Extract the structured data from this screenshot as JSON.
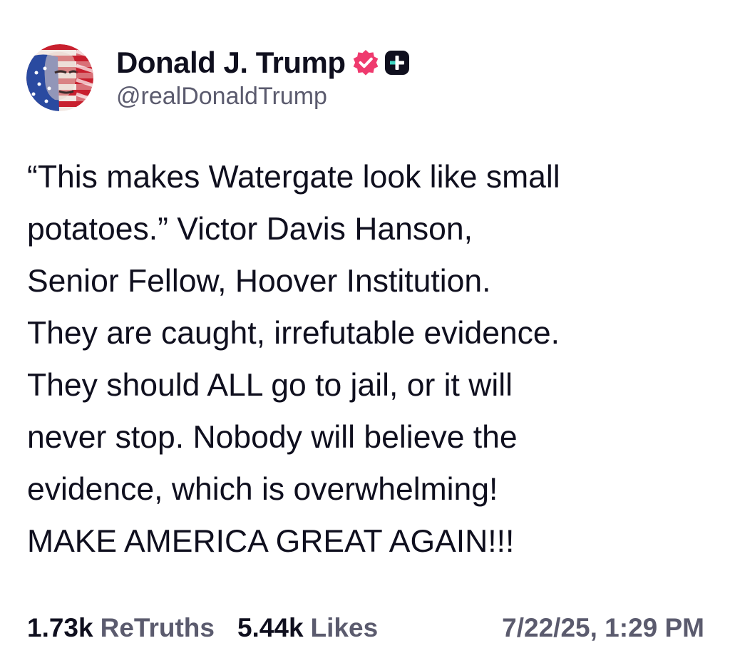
{
  "author": {
    "name": "Donald J. Trump",
    "handle": "@realDonaldTrump",
    "verified_color": "#ef3a6e",
    "plus_badge_color": "#0f0f1e",
    "avatar_icon": "profile-photo-flag-avatar"
  },
  "post": {
    "lines": [
      "“This makes Watergate look like small",
      "potatoes.” Victor Davis Hanson,",
      "Senior Fellow, Hoover Institution.",
      "They are caught, irrefutable evidence.",
      "They should ALL go to jail, or it will",
      "never stop. Nobody will believe the",
      "evidence, which is overwhelming!",
      "MAKE AMERICA GREAT AGAIN!!!"
    ]
  },
  "stats": {
    "retruths_count": "1.73k",
    "retruths_label": "ReTruths",
    "likes_count": "5.44k",
    "likes_label": "Likes",
    "timestamp": "7/22/25, 1:29 PM"
  }
}
